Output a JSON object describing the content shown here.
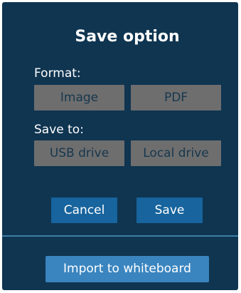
{
  "dialog": {
    "title": "Save option",
    "format": {
      "label": "Format:",
      "options": [
        "Image",
        "PDF"
      ]
    },
    "save_to": {
      "label": "Save to:",
      "options": [
        "USB drive",
        "Local drive"
      ]
    },
    "cancel_label": "Cancel",
    "save_label": "Save",
    "import_label": "Import to whiteboard"
  },
  "colors": {
    "background": "#0f3551",
    "option_button": "#6e6e6e",
    "option_text": "#17374e",
    "primary_button": "#17649e",
    "import_button": "#3a85bf",
    "divider": "#3d7ea3"
  }
}
